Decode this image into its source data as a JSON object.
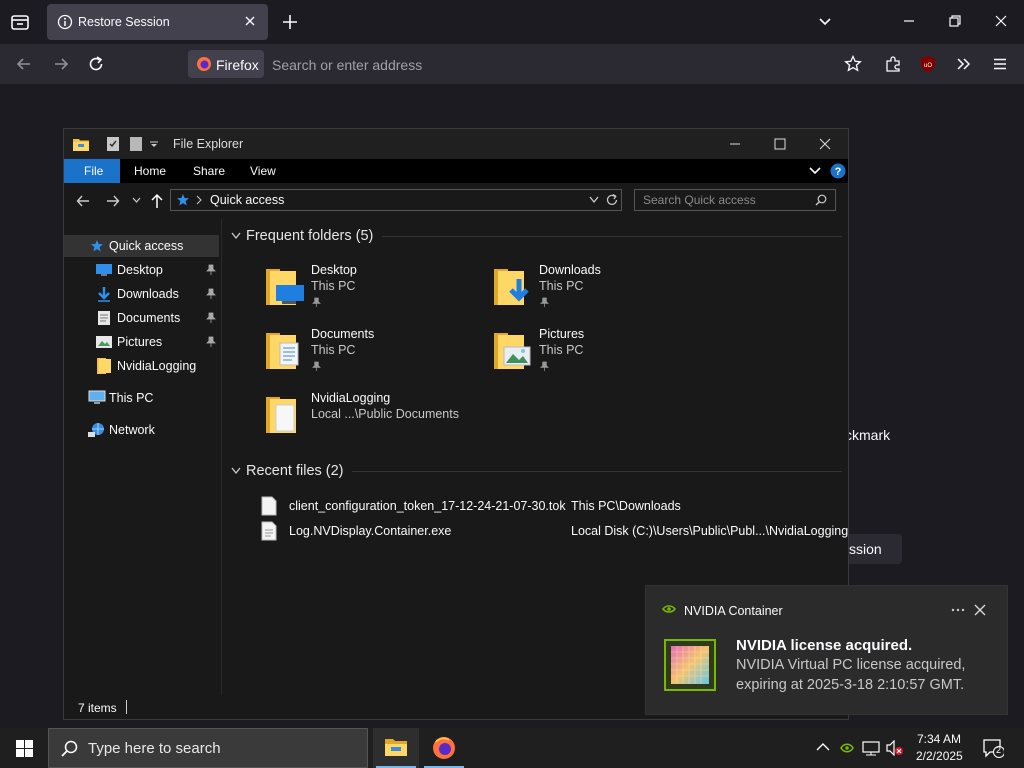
{
  "browser": {
    "tab_title": "Restore Session",
    "identity_label": "Firefox",
    "url_placeholder": "Search or enter address",
    "background_partial": {
      "checkmark_text": "ckmark",
      "button_text": "ssion"
    }
  },
  "explorer": {
    "title": "File Explorer",
    "ribbon_tabs": [
      "File",
      "Home",
      "Share",
      "View"
    ],
    "address": "Quick access",
    "search_placeholder": "Search Quick access",
    "sidebar": [
      {
        "label": "Quick access",
        "icon": "star-icon",
        "pinned": false
      },
      {
        "label": "Desktop",
        "icon": "desktop-folder-icon",
        "pinned": true
      },
      {
        "label": "Downloads",
        "icon": "downloads-icon",
        "pinned": true
      },
      {
        "label": "Documents",
        "icon": "documents-icon",
        "pinned": true
      },
      {
        "label": "Pictures",
        "icon": "pictures-icon",
        "pinned": true
      },
      {
        "label": "NvidiaLogging",
        "icon": "folder-icon",
        "pinned": false
      },
      {
        "label": "This PC",
        "icon": "this-pc-icon",
        "pinned": false
      },
      {
        "label": "Network",
        "icon": "network-icon",
        "pinned": false
      }
    ],
    "frequent_header": "Frequent folders (5)",
    "frequent": [
      {
        "name": "Desktop",
        "location": "This PC",
        "pinned": true
      },
      {
        "name": "Downloads",
        "location": "This PC",
        "pinned": true
      },
      {
        "name": "Documents",
        "location": "This PC",
        "pinned": true
      },
      {
        "name": "Pictures",
        "location": "This PC",
        "pinned": true
      },
      {
        "name": "NvidiaLogging",
        "location": "Local ...\\Public Documents",
        "pinned": false
      }
    ],
    "recent_header": "Recent files (2)",
    "recent": [
      {
        "name": "client_configuration_token_17-12-24-21-07-30.tok",
        "location": "This PC\\Downloads"
      },
      {
        "name": "Log.NVDisplay.Container.exe",
        "location": "Local Disk (C:)\\Users\\Public\\Publ...\\NvidiaLogging"
      }
    ],
    "status": "7 items"
  },
  "toast": {
    "app": "NVIDIA Container",
    "title": "NVIDIA license acquired.",
    "line1": "NVIDIA Virtual PC license acquired,",
    "line2": "expiring at 2025-3-18 2:10:57 GMT."
  },
  "taskbar": {
    "search_placeholder": "Type here to search",
    "time": "7:34 AM",
    "date": "2/2/2025",
    "notification_count": "2"
  },
  "colors": {
    "accent": "#0078d4",
    "nvidia_green": "#76b900",
    "firefox_bg": "#1c1b22"
  }
}
